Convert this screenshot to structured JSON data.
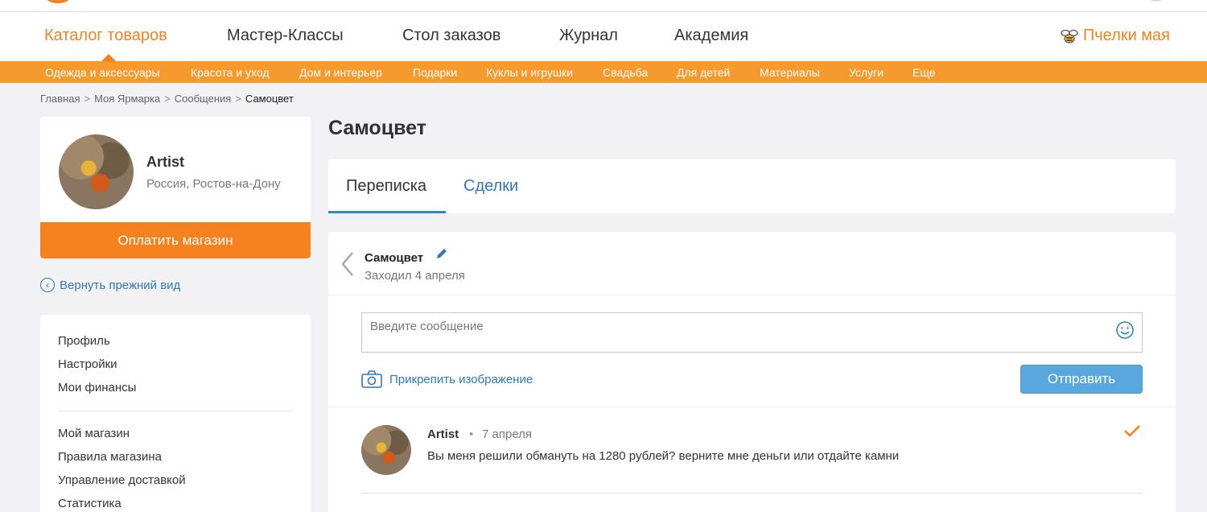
{
  "main_nav": {
    "items": [
      "Каталог товаров",
      "Мастер-Классы",
      "Стол заказов",
      "Журнал",
      "Академия"
    ],
    "bees_label": "Пчелки мая"
  },
  "category_bar": {
    "items": [
      "Одежда и аксессуары",
      "Красота и уход",
      "Дом и интерьер",
      "Подарки",
      "Куклы и игрушки",
      "Свадьба",
      "Для детей",
      "Материалы",
      "Услуги",
      "Еще"
    ]
  },
  "breadcrumb": {
    "items": [
      "Главная",
      "Моя Ярмарка",
      "Сообщения"
    ],
    "current": "Самоцвет",
    "separator": ">"
  },
  "profile": {
    "name": "Artist",
    "location": "Россия, Ростов-на-Дону",
    "pay_button": "Оплатить магазин"
  },
  "return_link": "Вернуть прежний вид",
  "side_menu": {
    "group1": [
      "Профиль",
      "Настройки",
      "Мои финансы"
    ],
    "group2": [
      "Мой магазин",
      "Правила магазина",
      "Управление доставкой",
      "Статистика"
    ]
  },
  "page_title": "Самоцвет",
  "tabs": [
    "Переписка",
    "Сделки"
  ],
  "chat": {
    "contact_name": "Самоцвет",
    "last_seen": "Заходил 4 апреля",
    "input_placeholder": "Введите сообщение",
    "attach_label": "Прикрепить изображение",
    "send_button": "Отправить"
  },
  "messages": [
    {
      "author": "Artist",
      "date": "7 апреля",
      "text": "Вы меня решили обмануть на 1280 рублей? верните мне деньги или отдайте камни"
    }
  ],
  "colors": {
    "accent_orange": "#f5821f",
    "category_bar": "#f69a2d",
    "link_blue": "#2f79b8",
    "send_button": "#5aa7dd"
  },
  "icons": [
    "bee-icon",
    "return-circle-icon",
    "back-chevron-icon",
    "edit-pencil-icon",
    "smile-icon",
    "camera-icon",
    "check-icon"
  ]
}
